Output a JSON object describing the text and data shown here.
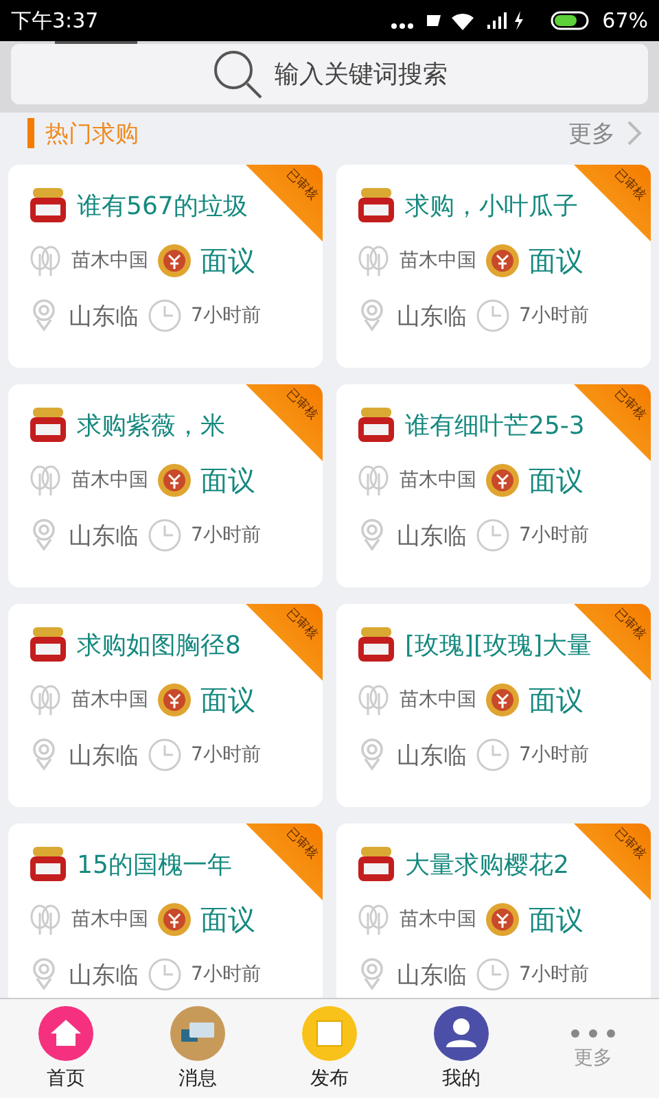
{
  "status_bar": {
    "time": "下午3:37",
    "battery": "67%"
  },
  "search": {
    "placeholder": "输入关键词搜索"
  },
  "section": {
    "title": "热门求购",
    "more": "更多"
  },
  "cards": [
    {
      "title": "谁有567的垃圾",
      "ribbon": "已审核",
      "source": "苗木中国",
      "price": "面议",
      "place": "山东临",
      "time": "7小时前"
    },
    {
      "title": "求购，小叶瓜子",
      "ribbon": "已审核",
      "source": "苗木中国",
      "price": "面议",
      "place": "山东临",
      "time": "7小时前"
    },
    {
      "title": "求购紫薇，米",
      "ribbon": "已审核",
      "source": "苗木中国",
      "price": "面议",
      "place": "山东临",
      "time": "7小时前"
    },
    {
      "title": "谁有细叶芒25-3",
      "ribbon": "已审核",
      "source": "苗木中国",
      "price": "面议",
      "place": "山东临",
      "time": "7小时前"
    },
    {
      "title": "求购如图胸径8",
      "ribbon": "已审核",
      "source": "苗木中国",
      "price": "面议",
      "place": "山东临",
      "time": "7小时前"
    },
    {
      "title": "[玫瑰][玫瑰]大量",
      "ribbon": "已审核",
      "source": "苗木中国",
      "price": "面议",
      "place": "山东临",
      "time": "7小时前"
    },
    {
      "title": "15的国槐一年",
      "ribbon": "已审核",
      "source": "苗木中国",
      "price": "面议",
      "place": "山东临",
      "time": "7小时前"
    },
    {
      "title": "大量求购樱花2",
      "ribbon": "已审核",
      "source": "苗木中国",
      "price": "面议",
      "place": "山东临",
      "time": "7小时前"
    }
  ],
  "tabs": [
    {
      "label": "首页",
      "kind": "home",
      "color": "#f5317f"
    },
    {
      "label": "消息",
      "kind": "message",
      "color": "#c89a5a"
    },
    {
      "label": "发布",
      "kind": "publish",
      "color": "#f8c21a"
    },
    {
      "label": "我的",
      "kind": "profile",
      "color": "#4c4fa8"
    },
    {
      "label": "更多",
      "kind": "more"
    }
  ]
}
